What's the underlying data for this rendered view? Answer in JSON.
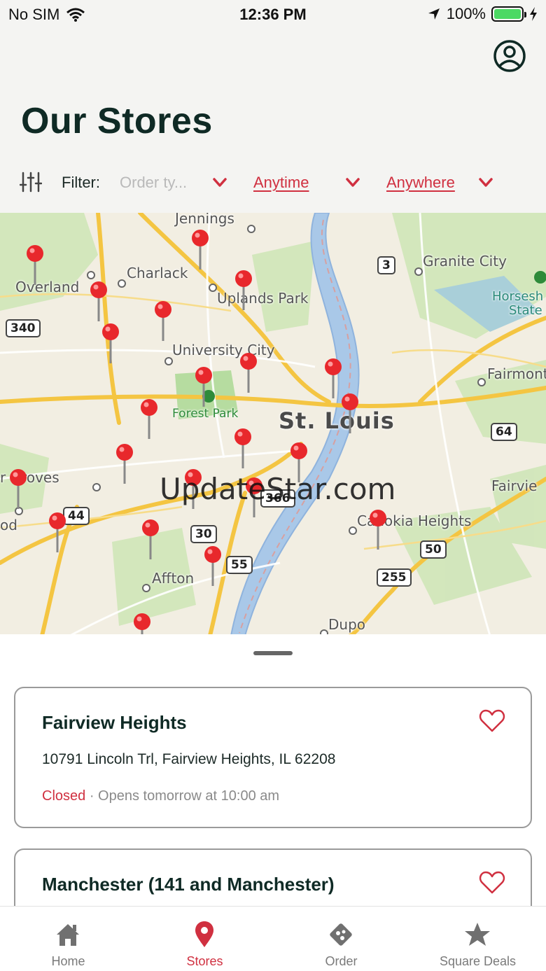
{
  "status_bar": {
    "carrier": "No SIM",
    "time": "12:36 PM",
    "battery": "100%"
  },
  "header": {
    "title": "Our Stores"
  },
  "filter": {
    "label": "Filter:",
    "order_type_placeholder": "Order ty...",
    "time_value": "Anytime",
    "place_value": "Anywhere"
  },
  "map": {
    "labels": {
      "jennings": "Jennings",
      "charlack": "Charlack",
      "overland": "Overland",
      "uplands_park": "Uplands Park",
      "university_city": "University City",
      "forest_park": "Forest Park",
      "st_louis": "St. Louis",
      "granite_city": "Granite City",
      "horseshoe": "Horsesh",
      "state": "State",
      "fairmont": "Fairmont",
      "fairview": "Fairvie",
      "groves": "r Groves",
      "od": "od",
      "cahokia_heights": "Cahokia Heights",
      "affton": "Affton",
      "dupo": "Dupo"
    },
    "shields": {
      "s340": "340",
      "s3": "3",
      "s64": "64",
      "s44": "44",
      "s30": "30",
      "s55": "55",
      "s366": "366",
      "s50": "50",
      "s255": "255"
    },
    "watermark": "UpdateStar.com"
  },
  "stores": [
    {
      "name": "Fairview Heights",
      "address": "10791 Lincoln Trl, Fairview Heights, IL 62208",
      "status": "Closed",
      "hours_detail": " · Opens tomorrow at 10:00 am"
    },
    {
      "name": "Manchester (141 and Manchester)"
    }
  ],
  "tabs": [
    {
      "label": "Home",
      "icon": "home-icon"
    },
    {
      "label": "Stores",
      "icon": "location-pin-icon"
    },
    {
      "label": "Order",
      "icon": "pizza-icon"
    },
    {
      "label": "Square Deals",
      "icon": "star-icon"
    }
  ],
  "colors": {
    "accent": "#d03040",
    "title": "#0f2a25",
    "background": "#f4f4f2"
  }
}
